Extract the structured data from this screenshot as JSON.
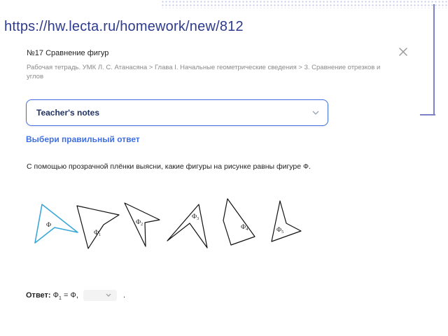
{
  "browser": {
    "url": "https://hw.lecta.ru/homework/new/812"
  },
  "task": {
    "title": "№17 Сравнение фигур",
    "breadcrumb": "Рабочая тетрадь. УМК Л. С. Атанасяна > Глава I. Начальные геометрические сведения > 3. Сравнение отрезков и углов"
  },
  "notes": {
    "label": "Teacher's notes"
  },
  "instruction": "Выбери правильный ответ",
  "question": "С помощью прозрачной плёнки выясни, какие фигуры на рисунке равны фигуре Ф.",
  "figures": {
    "labels": [
      {
        "base": "Ф",
        "sub": ""
      },
      {
        "base": "Ф",
        "sub": "1"
      },
      {
        "base": "Ф",
        "sub": "2"
      },
      {
        "base": "Ф",
        "sub": "3"
      },
      {
        "base": "Ф",
        "sub": "4"
      },
      {
        "base": "Ф",
        "sub": "5"
      }
    ],
    "highlight_color": "#3aa7d8"
  },
  "answer": {
    "label": "Ответ:",
    "lhs_base": "Ф",
    "lhs_sub": "1",
    "equals": "=",
    "rhs": "Ф,",
    "select_value": "",
    "end": "."
  },
  "colors": {
    "accent": "#3f6fe0",
    "url": "#2d3b8d",
    "breadcrumb": "#8a8a8a"
  }
}
